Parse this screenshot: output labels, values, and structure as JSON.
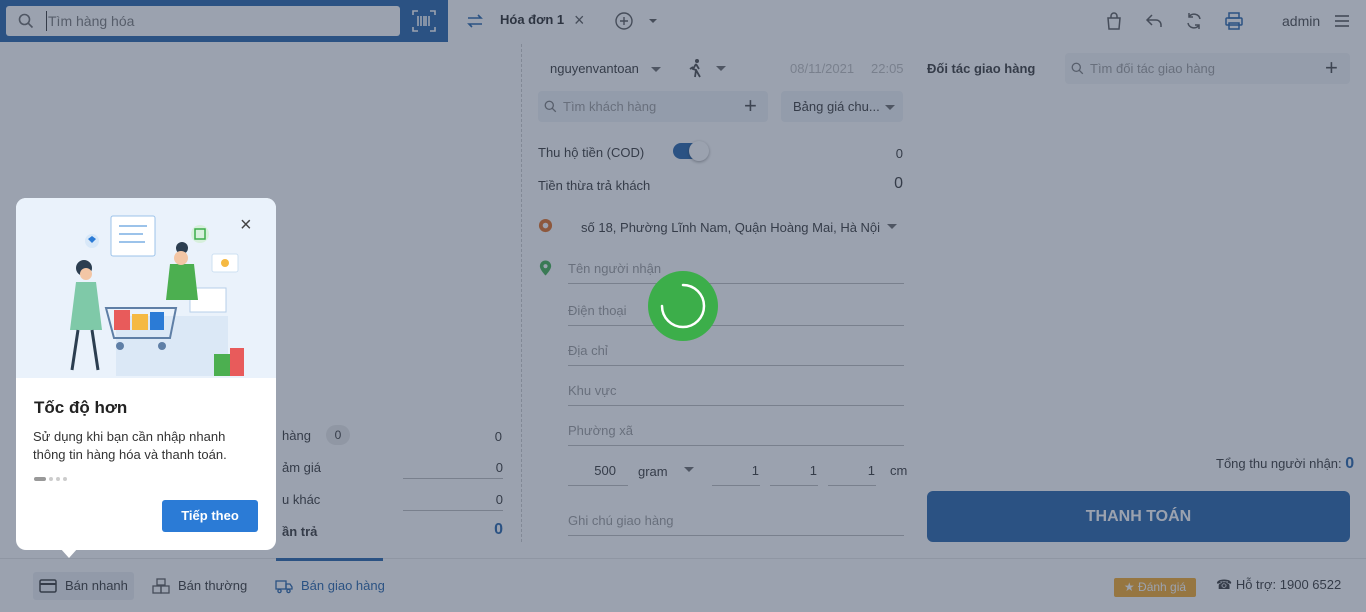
{
  "search": {
    "placeholder": "Tìm hàng hóa"
  },
  "tab": {
    "label": "Hóa đơn 1"
  },
  "user": {
    "name": "admin"
  },
  "order": {
    "seller": "nguyenvantoan",
    "date": "08/11/2021",
    "time": "22:05",
    "customer_placeholder": "Tìm khách hàng",
    "price_list": "Bảng giá chu...",
    "cod_label": "Thu hộ tiền (COD)",
    "cod_value": "0",
    "change_label": "Tiền thừa trả khách",
    "change_value": "0",
    "from_address": "số 18, Phường Lĩnh Nam, Quận Hoàng Mai, Hà Nội...",
    "receiver_name": "Tên người nhận",
    "phone": "Điện thoại",
    "address": "Địa chỉ",
    "area": "Khu vực",
    "ward": "Phường xã",
    "weight": "500",
    "weight_unit": "gram",
    "dim_l": "1",
    "dim_w": "1",
    "dim_h": "1",
    "dim_unit": "cm",
    "note": "Ghi chú giao hàng"
  },
  "summary": {
    "goods_label": "hàng",
    "goods_count": "0",
    "goods_value": "0",
    "discount_label": "ảm giá",
    "discount_value": "0",
    "other_label": "u khác",
    "other_value": "0",
    "pay_label": "ần trả",
    "pay_value": "0"
  },
  "delivery": {
    "partner_label": "Đối tác giao hàng",
    "partner_placeholder": "Tìm đối tác giao hàng",
    "total_label": "Tổng thu người nhận:",
    "total_value": "0",
    "pay_button": "THANH TOÁN"
  },
  "bottom": {
    "quick": "Bán nhanh",
    "normal": "Bán thường",
    "delivery": "Bán giao hàng",
    "rate": "Đánh giá",
    "support": "Hỗ trợ: 1900 6522"
  },
  "popup": {
    "title": "Tốc độ hơn",
    "description": "Sử dụng khi bạn cần nhập nhanh thông tin hàng hóa và thanh toán.",
    "next_button": "Tiếp theo"
  },
  "colors": {
    "primary": "#1e5fa6",
    "spinner": "#3cae4a",
    "rate": "#f5a623"
  }
}
